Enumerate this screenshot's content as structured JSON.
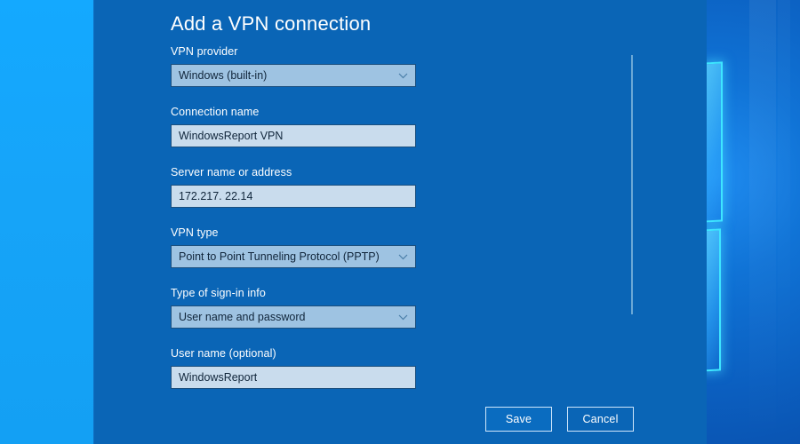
{
  "dialog": {
    "title": "Add a VPN connection",
    "fields": [
      {
        "key": "vpn_provider",
        "label": "VPN provider",
        "value": "Windows (built-in)",
        "control": "dropdown",
        "icon": "chevron-down-icon"
      },
      {
        "key": "connection_name",
        "label": "Connection name",
        "value": "WindowsReport VPN",
        "control": "textbox",
        "placeholder": ""
      },
      {
        "key": "server_address",
        "label": "Server name or address",
        "value": "172.217. 22.14",
        "control": "textbox",
        "placeholder": ""
      },
      {
        "key": "vpn_type",
        "label": "VPN type",
        "value": "Point to Point Tunneling Protocol (PPTP)",
        "control": "dropdown",
        "icon": "chevron-down-icon"
      },
      {
        "key": "signin_type",
        "label": "Type of sign-in info",
        "value": "User name and password",
        "control": "dropdown",
        "icon": "chevron-down-icon"
      },
      {
        "key": "user_name",
        "label": "User name (optional)",
        "value": "WindowsReport",
        "control": "textbox",
        "placeholder": ""
      }
    ],
    "buttons": {
      "save_label": "Save",
      "cancel_label": "Cancel"
    },
    "scrollbar": {
      "name": "vertical-scrollbar"
    }
  },
  "colors": {
    "dialog_background": "#0a65b6",
    "dropdown_fill": "#9ec3e2",
    "textbox_fill": "#c9dced",
    "control_border": "#1b4f7e",
    "primary_button_fill": "#0a6cc0",
    "button_border": "#cfe6fb",
    "text_on_dialog": "#ffffff",
    "text_in_control": "#10253a",
    "wallpaper_left": "#16a4f8",
    "wallpaper_glow": "#3ee6ff",
    "scrollbar_thumb": "#6ba8d6"
  }
}
